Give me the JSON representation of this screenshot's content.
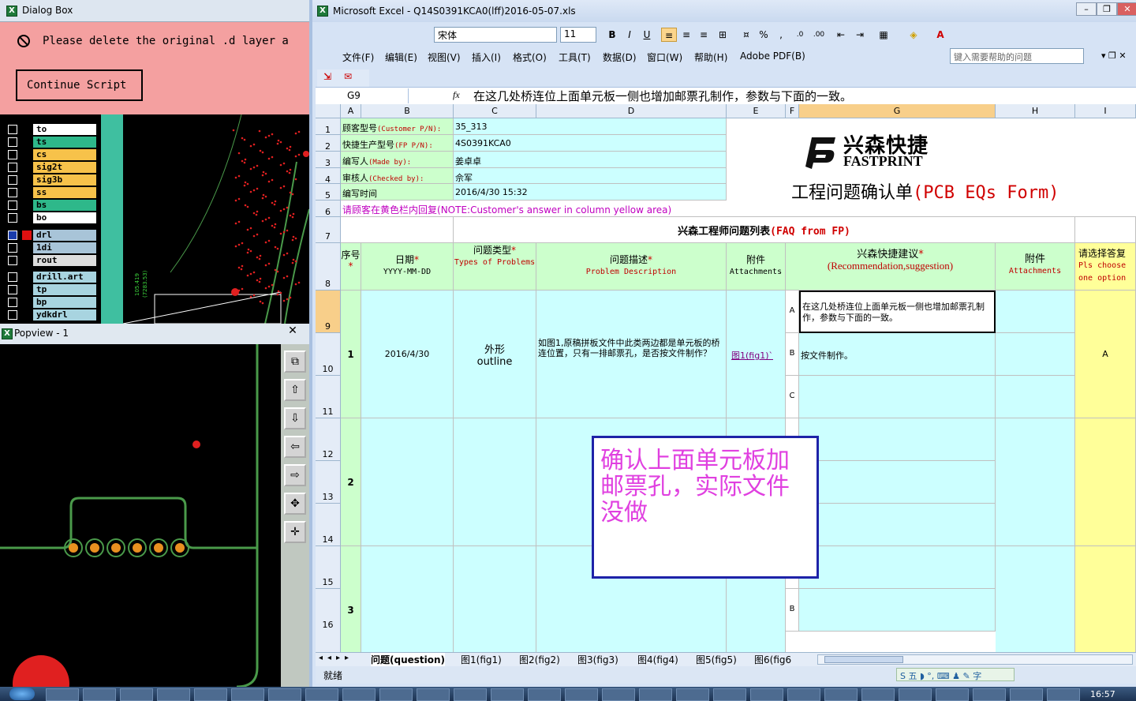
{
  "dialog": {
    "title": "Dialog Box",
    "message": "Please delete the original .d layer a",
    "continue_label": "Continue Script"
  },
  "layers": [
    {
      "name": "to",
      "color": "#ffffff"
    },
    {
      "name": "ts",
      "color": "#2eb88a"
    },
    {
      "name": "cs",
      "color": "#f7c24a"
    },
    {
      "name": "sig2t",
      "color": "#f7c24a"
    },
    {
      "name": "sig3b",
      "color": "#f7c24a"
    },
    {
      "name": "ss",
      "color": "#f7c24a"
    },
    {
      "name": "bs",
      "color": "#2eb88a"
    },
    {
      "name": "bo",
      "color": "#ffffff"
    },
    {
      "name": "drl",
      "color": "#a8c4d8"
    },
    {
      "name": "1di",
      "color": "#a8c4d8"
    },
    {
      "name": "rout",
      "color": "#dddddd"
    },
    {
      "name": "drill.art",
      "color": "#a8d4e0"
    },
    {
      "name": "tp",
      "color": "#a8d4e0"
    },
    {
      "name": "bp",
      "color": "#a8d4e0"
    },
    {
      "name": "ydkdrl",
      "color": "#a8d4e0"
    }
  ],
  "popview": {
    "title": "Popview - 1"
  },
  "excel": {
    "title": "Microsoft Excel - Q14S0391KCA0(lff)2016-05-07.xls",
    "font_name": "宋体",
    "font_size": "11",
    "menus": [
      "文件(F)",
      "编辑(E)",
      "视图(V)",
      "插入(I)",
      "格式(O)",
      "工具(T)",
      "数据(D)",
      "窗口(W)",
      "帮助(H)",
      "Adobe PDF(B)"
    ],
    "help_placeholder": "键入需要帮助的问题",
    "name_box": "G9",
    "formula": "在这几处桥连位上面单元板一侧也增加邮票孔制作，参数与下面的一致。",
    "columns": [
      "A",
      "B",
      "C",
      "D",
      "E",
      "F",
      "G",
      "H",
      "I"
    ],
    "rows": [
      "1",
      "2",
      "3",
      "4",
      "5",
      "6",
      "7",
      "8",
      "9",
      "10",
      "11",
      "12",
      "13",
      "14",
      "15",
      "16"
    ],
    "info": [
      {
        "label": "顾客型号",
        "label_en": "(Customer P/N):",
        "value": "35_313"
      },
      {
        "label": "快捷生产型号",
        "label_en": "(FP P/N):",
        "value": "4S0391KCA0"
      },
      {
        "label": "编写人",
        "label_en": "(Made by):",
        "value": "姜卓卓"
      },
      {
        "label": "审核人",
        "label_en": "(Checked by):",
        "value": "佘军"
      },
      {
        "label": "编写时间",
        "label_en": "",
        "value": "2016/4/30 15:32"
      }
    ],
    "logo_cn": "兴森快捷",
    "logo_en": "FASTPRINT",
    "form_title_cn": "工程问题确认单",
    "form_title_en": "(PCB EQs Form)",
    "row6_note_cn": "请顾客在黄色栏内回复",
    "row6_note_en": "(NOTE:Customer's answer in column yellow area)",
    "section_title_cn": "兴森工程师问题列表",
    "section_title_en": "(FAQ from FP)",
    "headers": {
      "seq": "序号",
      "date": "日期",
      "date_sub": "YYYY-MM-DD",
      "type": "问题类型",
      "type_sub": "Types of Problems",
      "desc": "问题描述",
      "desc_sub": "Problem Description",
      "att": "附件",
      "att_sub": "Attachments",
      "sugg": "兴森快捷建议",
      "sugg_sub": "(Recommendation,suggestion)",
      "att2": "附件",
      "att2_sub": "Attachments",
      "choose": "请选择答复",
      "choose_sub": "Pls choose one option"
    },
    "entry": {
      "seq": "1",
      "date": "2016/4/30",
      "type_cn": "外形",
      "type_en": "outline",
      "desc": "如图1,原稿拼板文件中此类两边都是单元板的桥连位置，只有一排邮票孔，是否按文件制作？",
      "attachment": "图1(fig1)`",
      "opt_a": "在这几处桥连位上面单元板一侧也增加邮票孔制作，参数与下面的一致。",
      "opt_b": "按文件制作。",
      "answer": "A"
    },
    "seq2": "2",
    "seq3": "3",
    "opt_labels": [
      "A",
      "B",
      "C"
    ],
    "note_box": "确认上面单元板加邮票孔，实际文件没做",
    "sheet_tabs": [
      "问题(question)",
      "图1(fig1)",
      "图2(fig2)",
      "图3(fig3)",
      "图4(fig4)",
      "图5(fig5)",
      "图6(fig6"
    ],
    "status": "就绪"
  },
  "taskbar": {
    "clock": "16:57"
  }
}
